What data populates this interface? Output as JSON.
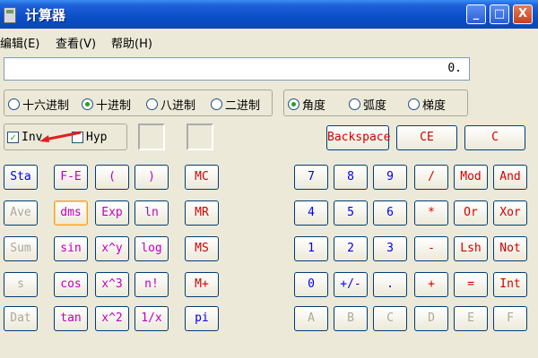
{
  "window": {
    "title": "计算器",
    "minimize": "_",
    "maximize": "□",
    "close": "X"
  },
  "menu": {
    "edit": "编辑(E)",
    "view": "查看(V)",
    "help": "帮助(H)"
  },
  "display": {
    "value": "0."
  },
  "base": {
    "hex": "十六进制",
    "dec": "十进制",
    "oct": "八进制",
    "bin": "二进制",
    "selected": "十进制"
  },
  "angle": {
    "deg": "角度",
    "rad": "弧度",
    "grad": "梯度",
    "selected": "角度"
  },
  "checks": {
    "inv": "Inv",
    "inv_checked": true,
    "hyp": "Hyp",
    "hyp_checked": false
  },
  "buttons": {
    "backspace": "Backspace",
    "ce": "CE",
    "c": "C",
    "sta": "Sta",
    "ave": "Ave",
    "sum": "Sum",
    "s": "s",
    "dat": "Dat",
    "fe": "F-E",
    "lparen": "(",
    "rparen": ")",
    "dms": "dms",
    "exp": "Exp",
    "ln": "ln",
    "sin": "sin",
    "xy": "x^y",
    "log": "log",
    "cos": "cos",
    "x3": "x^3",
    "nfact": "n!",
    "tan": "tan",
    "x2": "x^2",
    "recip": "1/x",
    "mc": "MC",
    "mr": "MR",
    "ms": "MS",
    "mplus": "M+",
    "pi": "pi",
    "d7": "7",
    "d8": "8",
    "d9": "9",
    "div": "/",
    "mod": "Mod",
    "and": "And",
    "d4": "4",
    "d5": "5",
    "d6": "6",
    "mul": "*",
    "or": "Or",
    "xor": "Xor",
    "d1": "1",
    "d2": "2",
    "d3": "3",
    "sub": "-",
    "lsh": "Lsh",
    "not": "Not",
    "d0": "0",
    "sign": "+/-",
    "dot": ".",
    "add": "+",
    "eq": "=",
    "int": "Int",
    "ha": "A",
    "hb": "B",
    "hc": "C",
    "hd": "D",
    "he": "E",
    "hf": "F"
  },
  "colors": {
    "title_bar": "#0a4ec8",
    "blue_keys": "#0000ee",
    "red_keys": "#d20000",
    "function_keys": "#c000c0",
    "radio_selected": "#21a121",
    "annotation_arrow": "#e02020"
  }
}
